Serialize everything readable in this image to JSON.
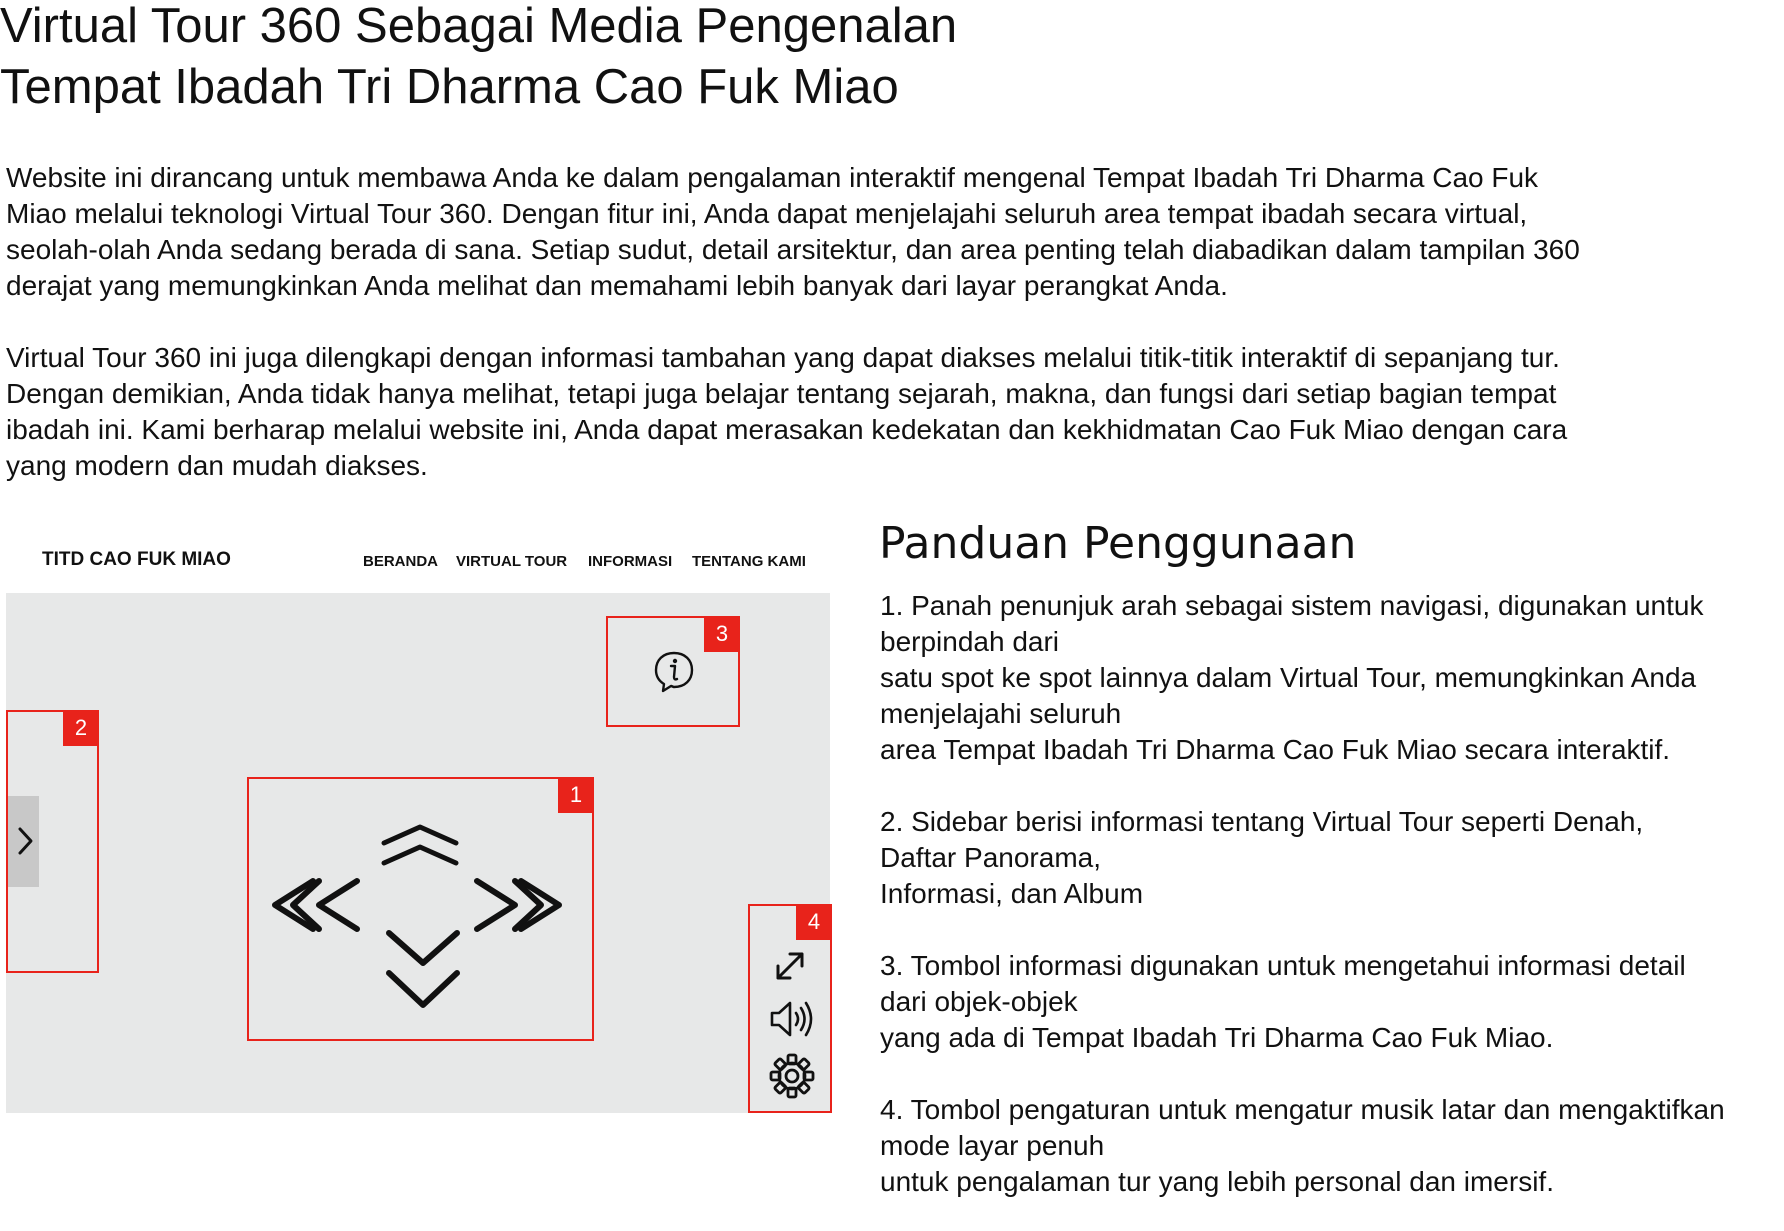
{
  "page": {
    "title_line1": "Virtual Tour 360 Sebagai Media Pengenalan",
    "title_line2": "Tempat Ibadah Tri Dharma Cao Fuk Miao"
  },
  "intro": {
    "p1": [
      "Website ini dirancang untuk membawa Anda ke dalam pengalaman interaktif mengenal Tempat Ibadah Tri Dharma Cao Fuk",
      "Miao melalui teknologi Virtual Tour 360. Dengan fitur ini, Anda dapat menjelajahi seluruh area tempat ibadah secara virtual,",
      "seolah-olah Anda sedang berada di sana. Setiap sudut, detail arsitektur, dan area penting telah diabadikan dalam tampilan 360",
      "derajat yang memungkinkan Anda melihat dan memahami lebih banyak dari layar perangkat Anda."
    ],
    "p2": [
      "Virtual Tour 360 ini juga dilengkapi dengan informasi tambahan yang dapat diakses melalui titik-titik interaktif di sepanjang tur.",
      "Dengan demikian, Anda tidak hanya melihat, tetapi juga belajar tentang sejarah, makna, dan fungsi dari setiap bagian tempat",
      "ibadah ini. Kami berharap melalui website ini, Anda dapat merasakan kedekatan dan kekhidmatan Cao Fuk Miao dengan cara",
      "yang modern dan mudah diakses."
    ]
  },
  "mockup": {
    "brand": "TITD CAO FUK MIAO",
    "nav": [
      "BERANDA",
      "VIRTUAL TOUR",
      "INFORMASI",
      "TENTANG KAMI"
    ],
    "callouts": {
      "nav_arrows": "1",
      "sidebar": "2",
      "info": "3",
      "settings": "4"
    },
    "icons": [
      "chevron-right-icon",
      "info-icon",
      "arrow-up-icon",
      "arrow-left-icon",
      "arrow-right-icon",
      "arrow-down-icon",
      "fullscreen-icon",
      "speaker-icon",
      "gear-icon"
    ],
    "colors": {
      "accent": "#e8231b",
      "viewer_bg": "#e7e8e8",
      "toggle_bg": "#c8c8c8"
    }
  },
  "guide": {
    "title": "Panduan Penggunaan",
    "items": [
      {
        "lines": [
          "1. Panah penunjuk arah sebagai sistem navigasi, digunakan untuk",
          "berpindah dari",
          "satu spot ke spot lainnya dalam Virtual Tour, memungkinkan Anda",
          "menjelajahi seluruh",
          "area Tempat Ibadah Tri Dharma Cao Fuk Miao secara interaktif."
        ]
      },
      {
        "lines": [
          "2. Sidebar berisi informasi tentang Virtual Tour seperti Denah,",
          "Daftar Panorama,",
          "Informasi, dan Album"
        ]
      },
      {
        "lines": [
          "3. Tombol informasi digunakan untuk mengetahui informasi detail",
          "dari objek-objek",
          "yang ada di Tempat Ibadah Tri Dharma Cao Fuk Miao."
        ]
      },
      {
        "lines": [
          "4. Tombol pengaturan untuk mengatur musik latar dan mengaktifkan",
          "mode layar penuh",
          "untuk pengalaman tur yang lebih personal dan imersif."
        ]
      }
    ]
  }
}
